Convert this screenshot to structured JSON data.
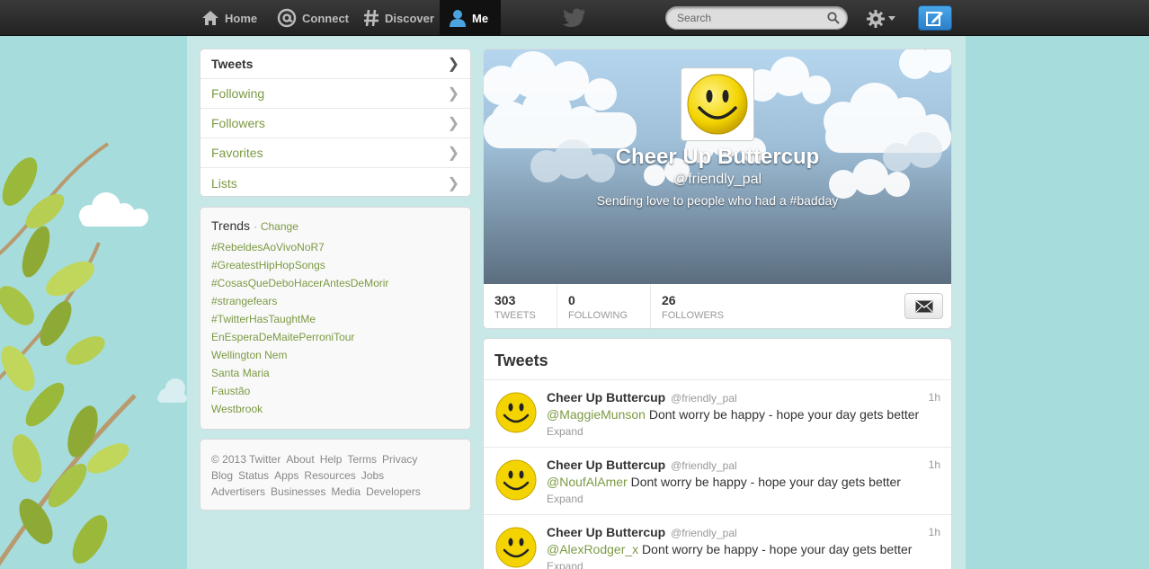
{
  "topbar": {
    "nav": [
      {
        "label": "Home",
        "icon": "home-icon"
      },
      {
        "label": "Connect",
        "icon": "at-icon"
      },
      {
        "label": "Discover",
        "icon": "hash-icon"
      },
      {
        "label": "Me",
        "icon": "person-icon"
      }
    ],
    "search_placeholder": "Search"
  },
  "sidebar": {
    "nav": [
      {
        "label": "Tweets",
        "active": true
      },
      {
        "label": "Following"
      },
      {
        "label": "Followers"
      },
      {
        "label": "Favorites"
      },
      {
        "label": "Lists"
      }
    ],
    "trends": {
      "title": "Trends",
      "separator": "·",
      "change_label": "Change",
      "items": [
        "#RebeldesAoVivoNoR7",
        "#GreatestHipHopSongs",
        "#CosasQueDeboHacerAntesDeMorir",
        "#strangefears",
        "#TwitterHasTaughtMe",
        "EnEsperaDeMaitePerroniTour",
        "Wellington Nem",
        "Santa Maria",
        "Faustão",
        "Westbrook"
      ]
    },
    "footer": {
      "line1": [
        "© 2013 Twitter",
        "About",
        "Help",
        "Terms",
        "Privacy"
      ],
      "line2": [
        "Blog",
        "Status",
        "Apps",
        "Resources",
        "Jobs"
      ],
      "line3": [
        "Advertisers",
        "Businesses",
        "Media",
        "Developers"
      ]
    }
  },
  "profile": {
    "name": "Cheer Up Buttercup",
    "handle": "@friendly_pal",
    "bio": "Sending love to people who had a #badday",
    "stats": [
      {
        "value": "303",
        "label": "TWEETS"
      },
      {
        "value": "0",
        "label": "FOLLOWING"
      },
      {
        "value": "26",
        "label": "FOLLOWERS"
      }
    ]
  },
  "timeline": {
    "title": "Tweets",
    "tweets": [
      {
        "name": "Cheer Up Buttercup",
        "handle": "@friendly_pal",
        "time": "1h",
        "mention": "@MaggieMunson",
        "text": " Dont worry be happy - hope your day gets better",
        "expand": "Expand"
      },
      {
        "name": "Cheer Up Buttercup",
        "handle": "@friendly_pal",
        "time": "1h",
        "mention": "@NoufAlAmer",
        "text": " Dont worry be happy - hope your day gets better",
        "expand": "Expand"
      },
      {
        "name": "Cheer Up Buttercup",
        "handle": "@friendly_pal",
        "time": "1h",
        "mention": "@AlexRodger_x",
        "text": " Dont worry be happy - hope your day gets better",
        "expand": "Expand"
      }
    ]
  },
  "colors": {
    "accent": "#7c9a44",
    "background": "#c5e7e8",
    "topbar": "#2b2b2b",
    "compose": "#2a7fc9"
  }
}
